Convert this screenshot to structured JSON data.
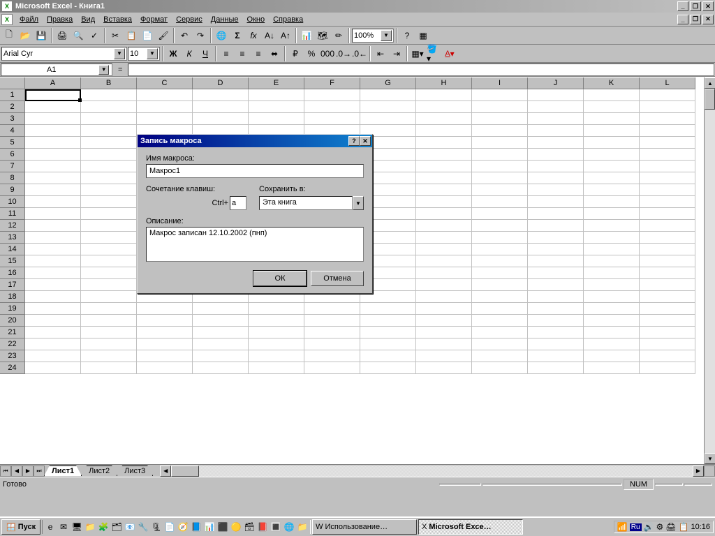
{
  "title": "Microsoft Excel - Книга1",
  "menu": [
    "Файл",
    "Правка",
    "Вид",
    "Вставка",
    "Формат",
    "Сервис",
    "Данные",
    "Окно",
    "Справка"
  ],
  "font": {
    "name": "Arial Cyr",
    "size": "10"
  },
  "zoom": "100%",
  "namebox": "A1",
  "formula_prefix": "=",
  "columns": [
    "A",
    "B",
    "C",
    "D",
    "E",
    "F",
    "G",
    "H",
    "I",
    "J",
    "K",
    "L"
  ],
  "rows": [
    "1",
    "2",
    "3",
    "4",
    "5",
    "6",
    "7",
    "8",
    "9",
    "10",
    "11",
    "12",
    "13",
    "14",
    "15",
    "16",
    "17",
    "18",
    "19",
    "20",
    "21",
    "22",
    "23",
    "24"
  ],
  "sheets": [
    "Лист1",
    "Лист2",
    "Лист3"
  ],
  "status": "Готово",
  "indicator": "NUM",
  "dialog": {
    "title": "Запись макроса",
    "name_label": "Имя макроса:",
    "name_value": "Макрос1",
    "shortcut_label": "Сочетание клавиш:",
    "shortcut_prefix": "Ctrl+",
    "shortcut_key": "a",
    "store_label": "Сохранить в:",
    "store_value": "Эта книга",
    "desc_label": "Описание:",
    "desc_value": "Макрос записан 12.10.2002 (пнп)",
    "ok": "ОК",
    "cancel": "Отмена"
  },
  "taskbar": {
    "start": "Пуск",
    "task1": "Использование…",
    "task2": "Microsoft Exce…",
    "lang": "Ru",
    "time": "10:16"
  }
}
